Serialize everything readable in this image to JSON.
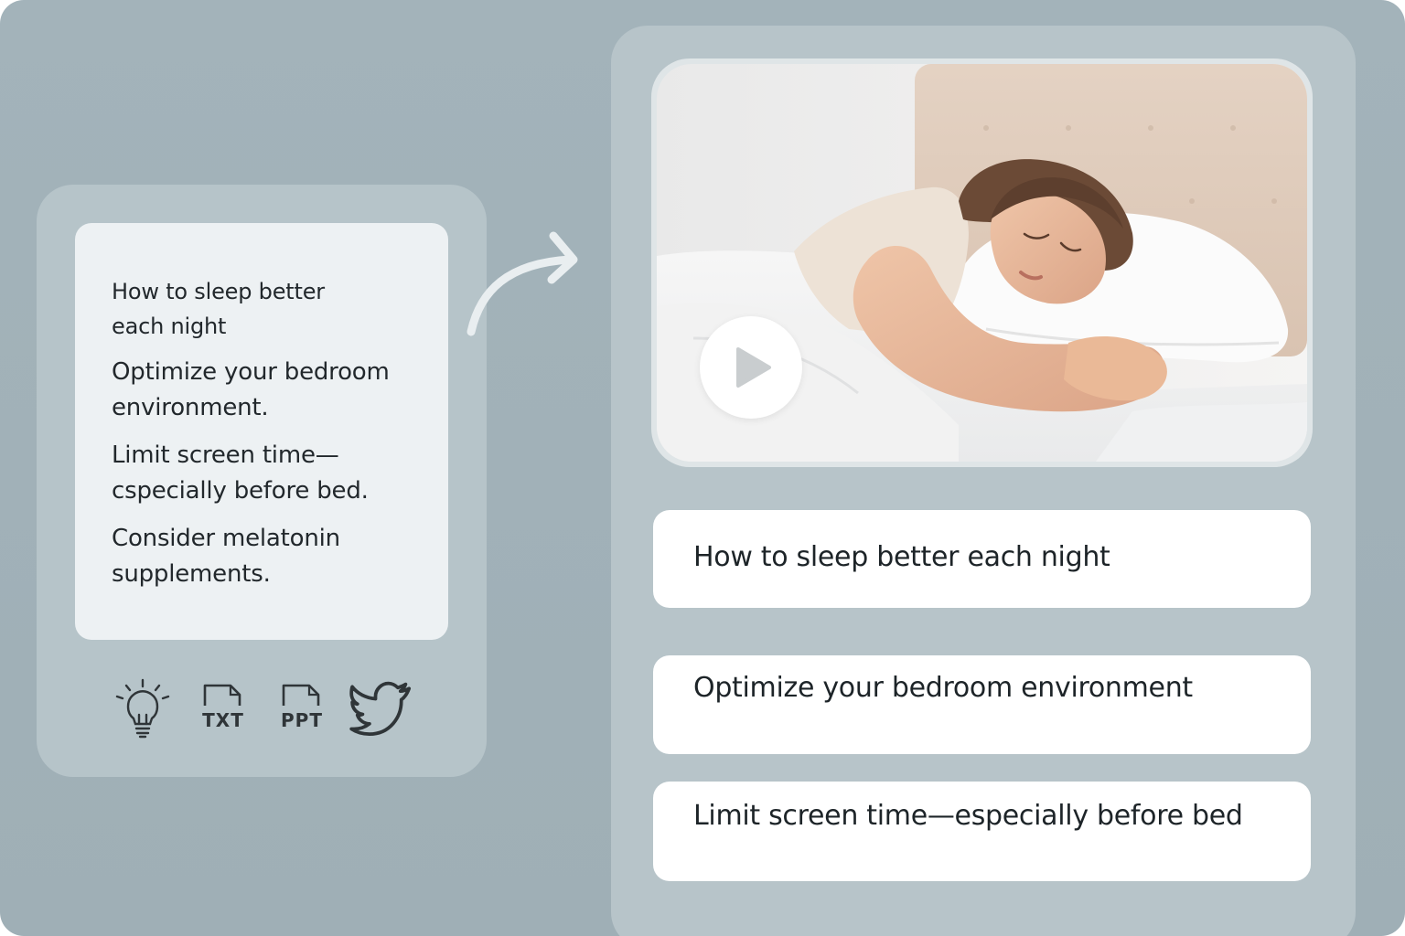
{
  "script_panel": {
    "title": "How to sleep better each night",
    "items": [
      "Optimize your bedroom environment.",
      "Limit screen time—cspecially before  bed.",
      "Consider melatonin supplements."
    ]
  },
  "export_icons": [
    {
      "name": "lightbulb-icon",
      "label": ""
    },
    {
      "name": "txt-file-icon",
      "label": "TXT"
    },
    {
      "name": "ppt-file-icon",
      "label": "PPT"
    },
    {
      "name": "twitter-icon",
      "label": ""
    }
  ],
  "video_panel": {
    "image_description_icon": "sleeping-woman-image",
    "play_icon": "play-icon",
    "scenes": [
      "How to sleep better each night",
      "Optimize your bedroom environment",
      "Limit screen time—especially before bed"
    ]
  },
  "colors": {
    "background": "#a3b3ba",
    "panel": "#b7c4c9",
    "note_card": "#edf1f3",
    "text": "#22282c",
    "icon": "#2f3538"
  }
}
